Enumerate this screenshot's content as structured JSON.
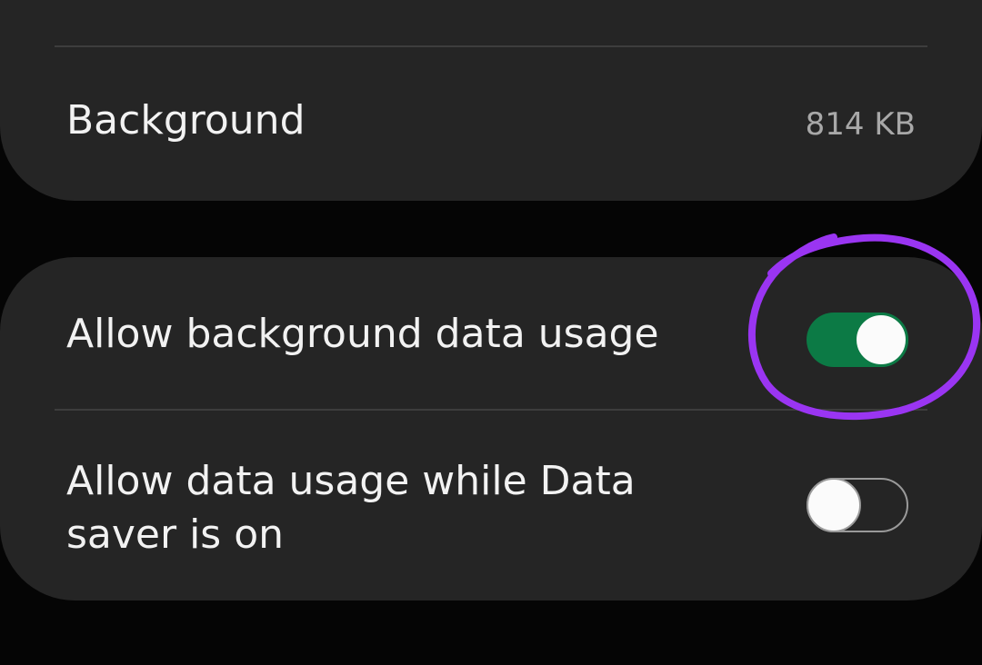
{
  "rows": {
    "background": {
      "label": "Background",
      "value": "814 KB"
    },
    "allow_background_data": {
      "label": "Allow background data usage",
      "enabled": true
    },
    "allow_data_saver": {
      "label_line1": "Allow data usage while Data",
      "label_line2": "saver is on",
      "enabled": false
    }
  },
  "colors": {
    "card": "#252525",
    "screen_bg": "#050505",
    "switch_on": "#0c7a45",
    "annotation_stroke": "#9a35f2"
  }
}
